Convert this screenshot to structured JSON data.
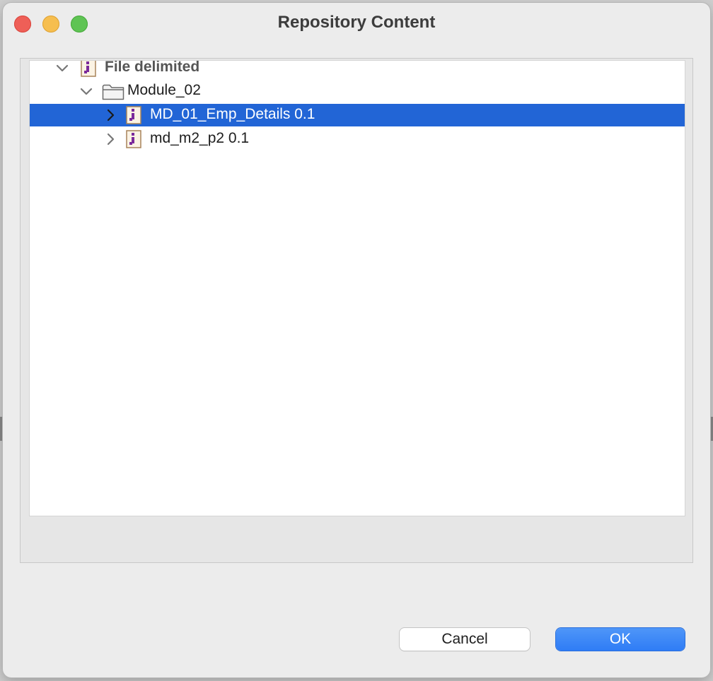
{
  "window": {
    "title": "Repository Content"
  },
  "tree": {
    "items": [
      {
        "label": "File delimited",
        "expanded": true,
        "icon": "file-delimited-icon",
        "level": 0,
        "selected": false
      },
      {
        "label": "Module_02",
        "expanded": true,
        "icon": "folder-icon",
        "level": 1,
        "selected": false
      },
      {
        "label": "MD_01_Emp_Details 0.1",
        "expanded": false,
        "icon": "file-delimited-icon",
        "level": 2,
        "selected": true
      },
      {
        "label": "md_m2_p2 0.1",
        "expanded": false,
        "icon": "file-delimited-icon",
        "level": 2,
        "selected": false
      }
    ]
  },
  "buttons": {
    "cancel_label": "Cancel",
    "ok_label": "OK"
  },
  "colors": {
    "selection": "#2265d6",
    "ok_button": "#2f7cf6",
    "icon_accent": "#7b2a9b"
  }
}
